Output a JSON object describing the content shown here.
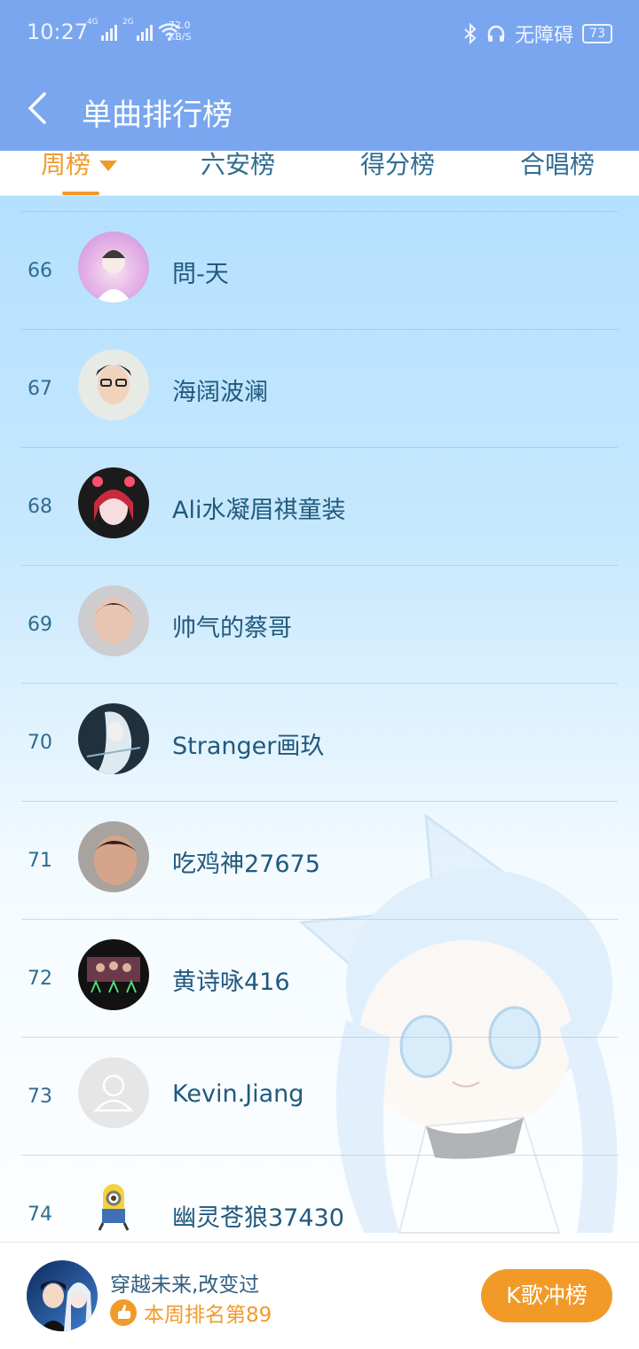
{
  "status_bar": {
    "time": "10:27",
    "net1": "4G",
    "net2": "2G",
    "speed_value": "72.0",
    "speed_unit": "KB/S",
    "accessibility": "无障碍",
    "battery": "73"
  },
  "header": {
    "title": "单曲排行榜"
  },
  "tabs": [
    {
      "label": "周榜"
    },
    {
      "label": "六安榜"
    },
    {
      "label": "得分榜"
    },
    {
      "label": "合唱榜"
    }
  ],
  "list": [
    {
      "rank": "66",
      "name": "問-天"
    },
    {
      "rank": "67",
      "name": "海阔波澜"
    },
    {
      "rank": "68",
      "name": "Ali水凝眉祺童装"
    },
    {
      "rank": "69",
      "name": "帅气的蔡哥"
    },
    {
      "rank": "70",
      "name": "Stranger画玖"
    },
    {
      "rank": "71",
      "name": "吃鸡神27675"
    },
    {
      "rank": "72",
      "name": "黄诗咏416"
    },
    {
      "rank": "73",
      "name": "Kevin.Jiang"
    },
    {
      "rank": "74",
      "name": "幽灵苍狼37430"
    }
  ],
  "me": {
    "name": "穿越未来,改变过",
    "rank_text": "本周排名第89"
  },
  "button": {
    "label": "K歌冲榜"
  },
  "colors": {
    "accent": "#f19a2c",
    "header": "#79a6ef",
    "text": "#21597e"
  }
}
